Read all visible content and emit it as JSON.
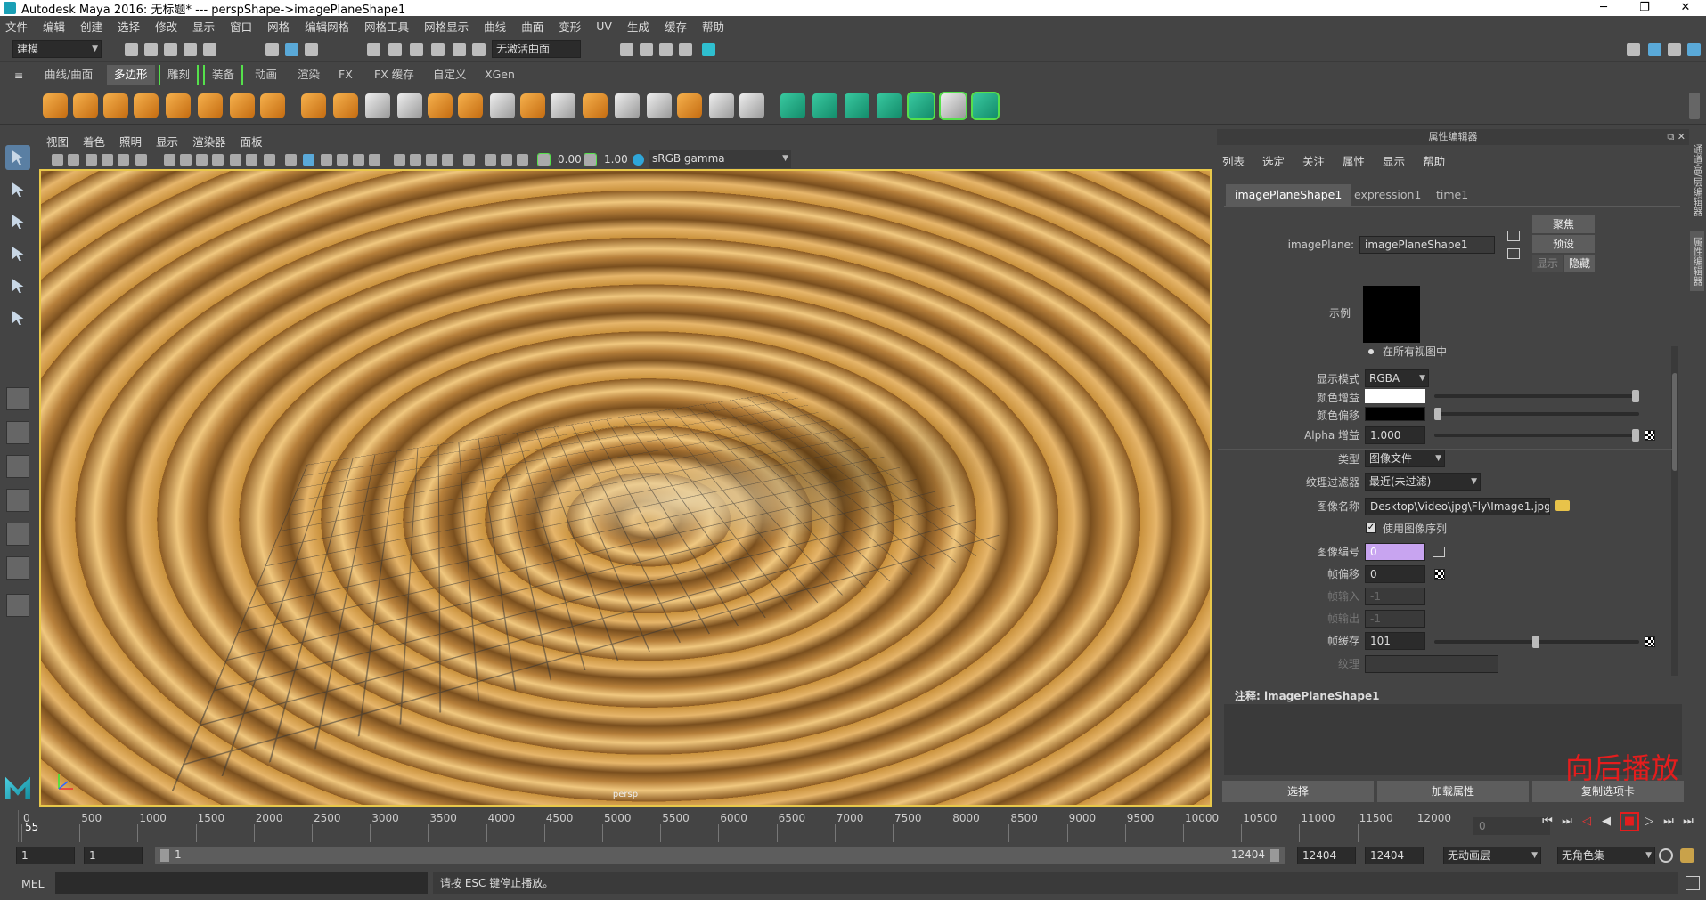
{
  "window": {
    "title": "Autodesk Maya 2016: 无标题*   ---   perspShape->imagePlaneShape1",
    "minimize": "─",
    "restore": "❐",
    "close": "✕"
  },
  "menubar": [
    "文件",
    "编辑",
    "创建",
    "选择",
    "修改",
    "显示",
    "窗口",
    "网格",
    "编辑网格",
    "网格工具",
    "网格显示",
    "曲线",
    "曲面",
    "变形",
    "UV",
    "生成",
    "缓存",
    "帮助"
  ],
  "toolbar": {
    "mode": "建模",
    "live_surface": "无激活曲面"
  },
  "shelf_tabs": [
    "曲线/曲面",
    "多边形",
    "雕刻",
    "装备",
    "动画",
    "渲染",
    "FX",
    "FX 缓存",
    "自定义",
    "XGen"
  ],
  "viewport": {
    "menu": [
      "视图",
      "着色",
      "照明",
      "显示",
      "渲染器",
      "面板"
    ],
    "exposure": "0.00",
    "gamma": "1.00",
    "colorspace": "sRGB gamma",
    "camera": "persp"
  },
  "attribute_editor": {
    "header": "属性编辑器",
    "menu": [
      "列表",
      "选定",
      "关注",
      "属性",
      "显示",
      "帮助"
    ],
    "tabs": [
      "imagePlaneShape1",
      "expression1",
      "time1"
    ],
    "node_label": "imagePlane:",
    "node_value": "imagePlaneShape1",
    "buttons": {
      "focus": "聚焦",
      "preset": "预设",
      "show": "显示",
      "hide": "隐藏"
    },
    "swatch_label": "示例",
    "all_views": "在所有视图中",
    "display_mode_label": "显示模式",
    "display_mode": "RGBA",
    "color_gain_label": "颜色增益",
    "color_offset_label": "颜色偏移",
    "alpha_gain_label": "Alpha 增益",
    "alpha_gain": "1.000",
    "type_label": "类型",
    "type": "图像文件",
    "filter_label": "纹理过滤器",
    "filter": "最近(未过滤)",
    "image_name_label": "图像名称",
    "image_name": "Desktop\\Video\\jpg\\Fly\\Image1.jpg",
    "use_sequence": "使用图像序列",
    "image_number_label": "图像编号",
    "image_number": "0",
    "frame_offset_label": "帧偏移",
    "frame_offset": "0",
    "frame_in_label": "帧输入",
    "frame_in": "-1",
    "frame_out_label": "帧输出",
    "frame_out": "-1",
    "frame_cache_label": "帧缓存",
    "frame_cache": "101",
    "texture_label": "纹理",
    "notes_label": "注释: imagePlaneShape1",
    "bottom_buttons": [
      "选择",
      "加载属性",
      "复制选项卡"
    ]
  },
  "side_tabs": [
    "通道盒/层编辑器",
    "属性编辑器"
  ],
  "timeline": {
    "current_frame": "55",
    "ticks": [
      "0",
      "500",
      "1000",
      "1500",
      "2000",
      "2500",
      "3000",
      "3500",
      "4000",
      "4500",
      "5000",
      "5500",
      "6000",
      "6500",
      "7000",
      "7500",
      "8000",
      "8500",
      "9000",
      "9500",
      "10000",
      "10500",
      "11000",
      "11500",
      "12000"
    ],
    "field": "0"
  },
  "range": {
    "start": "1",
    "anim_start": "1",
    "range_start": "1",
    "range_end_label": "12404",
    "end": "12404",
    "anim_end": "12404",
    "anim_layer": "无动画层",
    "char_set": "无角色集"
  },
  "cmd": {
    "lang": "MEL",
    "status": "请按 ESC 键停止播放。"
  },
  "overlay_text": "向后播放"
}
